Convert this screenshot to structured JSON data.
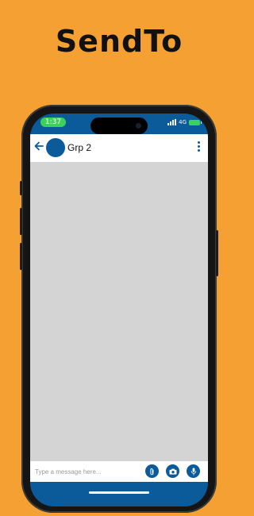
{
  "promo": {
    "title": "SendTo"
  },
  "status_bar": {
    "time": "1:37",
    "network": "4G"
  },
  "chat": {
    "title": "Grp 2",
    "composer": {
      "placeholder": "Type a message here..."
    }
  },
  "icons": {
    "back": "arrow-left-icon",
    "more": "more-vertical-icon",
    "attach": "paperclip-icon",
    "camera": "camera-icon",
    "mic": "microphone-icon"
  },
  "colors": {
    "background": "#f5a033",
    "primary": "#0b5a99",
    "chat_area": "#d4d4d4",
    "status_green": "#3bd15b"
  }
}
